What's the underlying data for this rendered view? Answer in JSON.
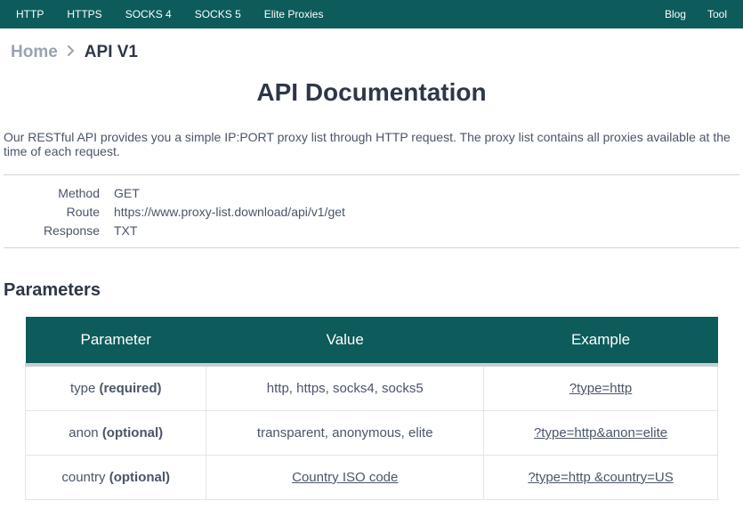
{
  "nav": {
    "left": [
      "HTTP",
      "HTTPS",
      "SOCKS 4",
      "SOCKS 5",
      "Elite Proxies"
    ],
    "right": [
      "Blog",
      "Tool"
    ]
  },
  "breadcrumb": {
    "home": "Home",
    "current": "API V1"
  },
  "title": "API Documentation",
  "intro": "Our RESTful API provides you a simple IP:PORT proxy list through HTTP request. The proxy list contains all proxies available at the time of each request.",
  "info": {
    "rows": [
      {
        "label": "Method",
        "value": "GET"
      },
      {
        "label": "Route",
        "value": "https://www.proxy-list.download/api/v1/get"
      },
      {
        "label": "Response",
        "value": "TXT"
      }
    ]
  },
  "params_heading": "Parameters",
  "params_table": {
    "headers": [
      "Parameter",
      "Value",
      "Example"
    ],
    "rows": [
      {
        "param_name": "type",
        "param_suffix": "(required)",
        "value_text": "http, https, socks4, socks5",
        "value_is_link": false,
        "example": "?type=http"
      },
      {
        "param_name": "anon",
        "param_suffix": "(optional)",
        "value_text": "transparent, anonymous, elite",
        "value_is_link": false,
        "example": "?type=http&anon=elite"
      },
      {
        "param_name": "country",
        "param_suffix": "(optional)",
        "value_text": "Country ISO code",
        "value_is_link": true,
        "example": "?type=http &country=US"
      }
    ]
  }
}
